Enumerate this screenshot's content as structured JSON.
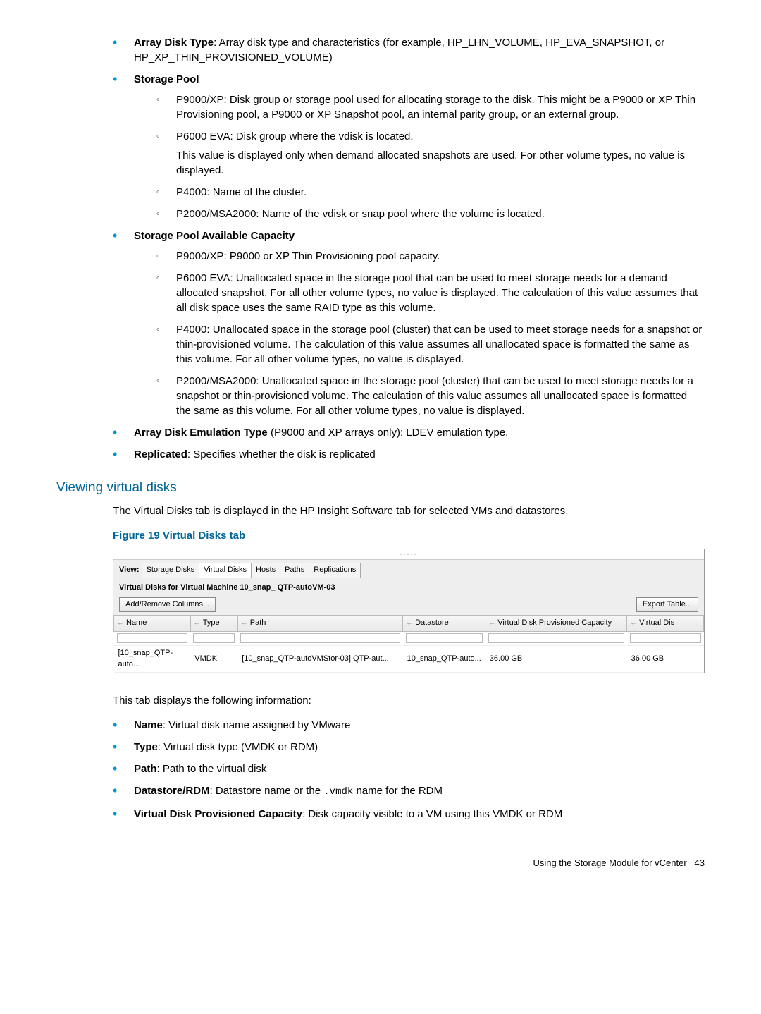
{
  "bullets": {
    "arrayDiskType": {
      "label": "Array Disk Type",
      "text": ": Array disk type and characteristics (for example, HP_LHN_VOLUME, HP_EVA_SNAPSHOT, or HP_XP_THIN_PROVISIONED_VOLUME)"
    },
    "storagePool": {
      "label": "Storage Pool",
      "subs": {
        "p9000xp": "P9000/XP: Disk group or storage pool used for allocating storage to the disk. This might be a P9000 or XP Thin Provisioning pool, a P9000 or XP Snapshot pool, an internal parity group, or an external group.",
        "p6000eva_a": "P6000 EVA: Disk group where the vdisk is located.",
        "p6000eva_b": "This value is displayed only when demand allocated snapshots are used. For other volume types, no value is displayed.",
        "p4000": "P4000: Name of the cluster.",
        "p2000": "P2000/MSA2000: Name of the vdisk or snap pool where the volume is located."
      }
    },
    "storagePoolAvail": {
      "label": "Storage Pool Available Capacity",
      "subs": {
        "p9000xp": "P9000/XP: P9000 or XP Thin Provisioning pool capacity.",
        "p6000eva": "P6000 EVA: Unallocated space in the storage pool that can be used to meet storage needs for a demand allocated snapshot. For all other volume types, no value is displayed. The calculation of this value assumes that all disk space uses the same RAID type as this volume.",
        "p4000": "P4000: Unallocated space in the storage pool (cluster) that can be used to meet storage needs for a snapshot or thin-provisioned volume. The calculation of this value assumes all unallocated space is formatted the same as this volume. For all other volume types, no value is displayed.",
        "p2000": "P2000/MSA2000: Unallocated space in the storage pool (cluster) that can be used to meet storage needs for a snapshot or thin-provisioned volume. The calculation of this value assumes all unallocated space is formatted the same as this volume. For all other volume types, no value is displayed."
      }
    },
    "arrayDiskEmu": {
      "label": "Array Disk Emulation Type",
      "text": " (P9000 and XP arrays only): LDEV emulation type."
    },
    "replicated": {
      "label": "Replicated",
      "text": ": Specifies whether the disk is replicated"
    }
  },
  "section": {
    "heading": "Viewing virtual disks",
    "intro": "The Virtual Disks tab is displayed in the HP Insight Software tab for selected VMs and datastores.",
    "figureCaption": "Figure 19 Virtual Disks tab"
  },
  "figure": {
    "viewLabel": "View:",
    "tabs": [
      "Storage Disks",
      "Virtual Disks",
      "Hosts",
      "Paths",
      "Replications"
    ],
    "activeTab": "Virtual Disks",
    "subtitle": "Virtual Disks for Virtual Machine 10_snap_ QTP-autoVM-03",
    "addRemove": "Add/Remove Columns...",
    "exportTable": "Export Table...",
    "columns": [
      "Name",
      "Type",
      "Path",
      "Datastore",
      "Virtual Disk Provisioned Capacity",
      "Virtual Dis"
    ],
    "row": {
      "name": "[10_snap_QTP-auto...",
      "type": "VMDK",
      "path": "[10_snap_QTP-autoVMStor-03] QTP-aut...",
      "datastore": "10_snap_QTP-auto...",
      "provCap": "36.00 GB",
      "vdis": "36.00 GB"
    }
  },
  "afterFigure": {
    "intro": "This tab displays the following information:",
    "items": {
      "name": {
        "label": "Name",
        "text": ": Virtual disk name assigned by VMware"
      },
      "type": {
        "label": "Type",
        "text": ": Virtual disk type (VMDK or RDM)"
      },
      "path": {
        "label": "Path",
        "text": ": Path to the virtual disk"
      },
      "datastore": {
        "label": "Datastore/RDM",
        "text_a": ": Datastore name or the ",
        "code": ".vmdk",
        "text_b": " name for the RDM"
      },
      "provCap": {
        "label": "Virtual Disk Provisioned Capacity",
        "text": ": Disk capacity visible to a VM using this VMDK or RDM"
      }
    }
  },
  "footer": {
    "text": "Using the Storage Module for vCenter",
    "page": "43"
  }
}
